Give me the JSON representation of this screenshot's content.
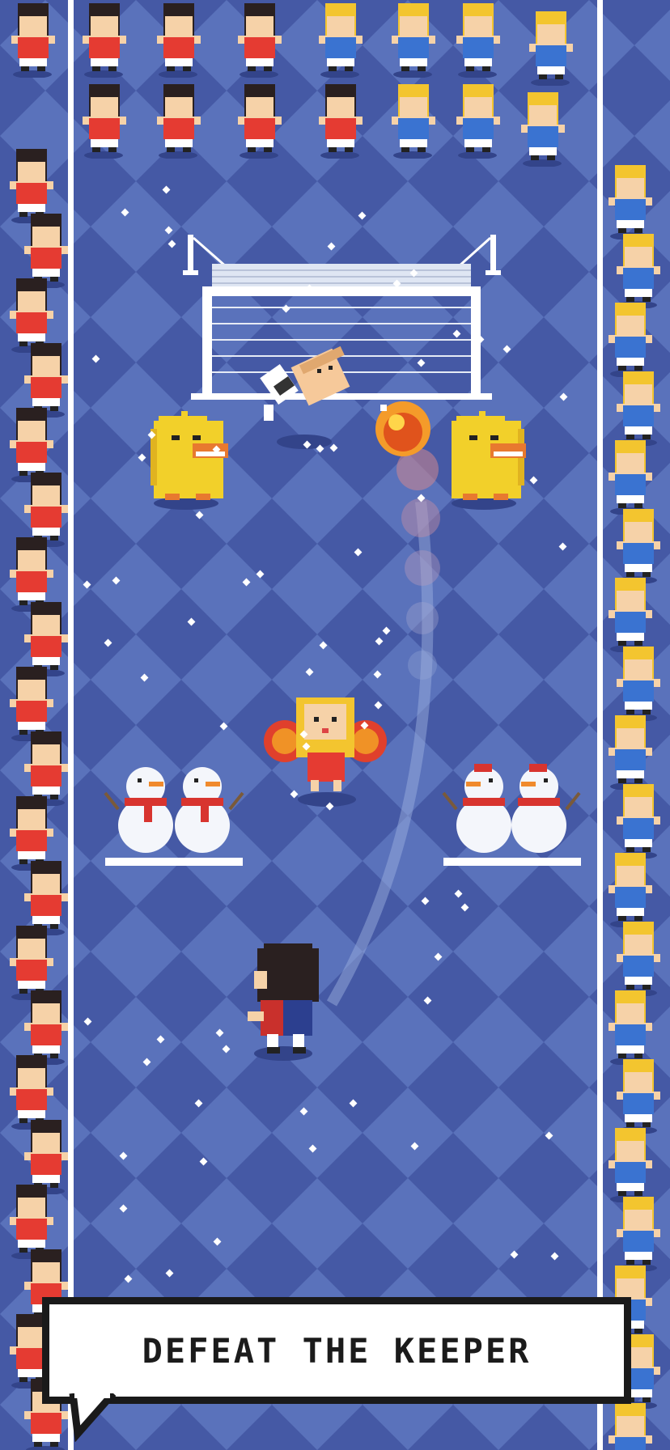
{
  "game": {
    "caption": "DEFEAT THE KEEPER",
    "colors": {
      "field_dark": "#4559a5",
      "field_light": "#5b74bb",
      "line": "#ffffff",
      "red_kit": "#e53b32",
      "blue_kit": "#3a73d1",
      "skin": "#f6d2a8",
      "hair_dark": "#2a2020",
      "hair_blond": "#f3c52f",
      "duck": "#f2d02a",
      "fireball": "#f07a1c"
    },
    "sprites": [
      {
        "name": "goal-net-icon"
      },
      {
        "name": "goalkeeper-icon"
      },
      {
        "name": "fireball-icon"
      },
      {
        "name": "duck-defender-left-icon"
      },
      {
        "name": "duck-defender-right-icon"
      },
      {
        "name": "cheerleader-icon"
      },
      {
        "name": "snowman-pair-left-icon"
      },
      {
        "name": "snowman-pair-right-icon"
      },
      {
        "name": "player-kicker-icon"
      }
    ]
  }
}
